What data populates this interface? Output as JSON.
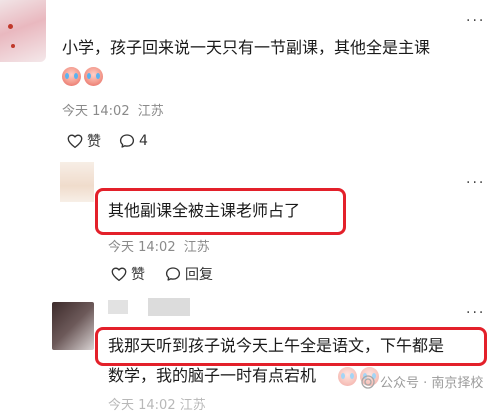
{
  "comments": [
    {
      "text": "小学，孩子回来说一天只有一节副课，其他全是主课",
      "emojis": [
        "crying-laugh-emoji",
        "crying-laugh-emoji"
      ],
      "time": "今天 14:02",
      "location": "江苏",
      "like_label": "赞",
      "reply_count": "4"
    },
    {
      "text": "其他副课全被主课老师占了",
      "time": "今天 14:02",
      "location": "江苏",
      "like_label": "赞",
      "reply_label": "回复"
    },
    {
      "text_line1": "我那天听到孩子说今天上午全是语文，下午都是",
      "text_line2": "数学，我的脑子一时有点宕机",
      "emojis": [
        "crying-laugh-emoji",
        "crying-laugh-emoji"
      ],
      "time_partial": "今天 14:02 江苏"
    }
  ],
  "more_label": "···",
  "watermark": {
    "text": "公众号 · 南京择校",
    "icon": "wechat-official-account-icon"
  },
  "colors": {
    "highlight_box": "#e3202a",
    "meta_text": "#8a8a8a"
  }
}
